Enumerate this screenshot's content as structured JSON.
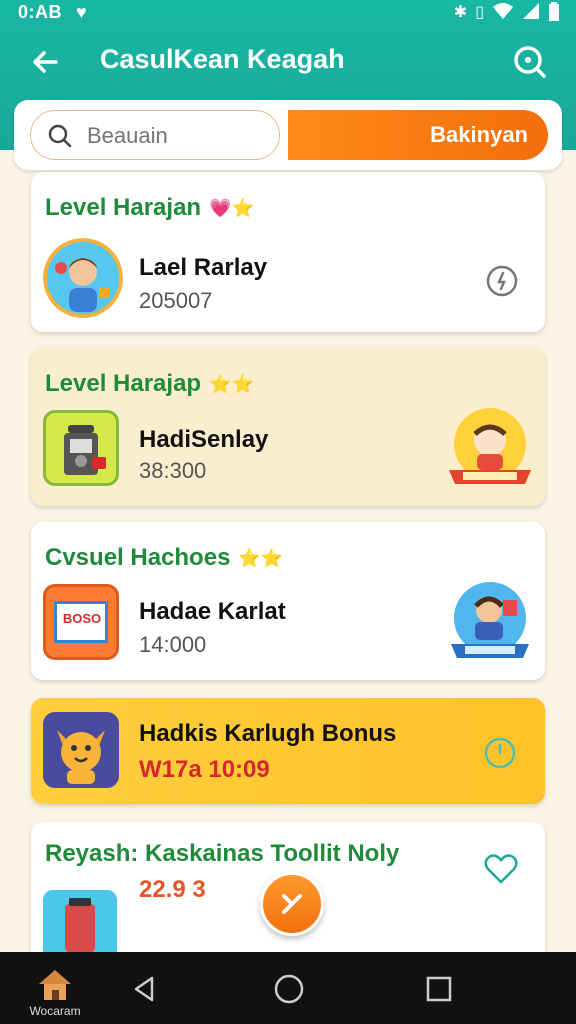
{
  "status": {
    "time": "0:AB",
    "icons": [
      "heart-icon",
      "bluetooth-icon",
      "vibrate-icon",
      "wifi-icon",
      "signal-icon",
      "battery-icon"
    ]
  },
  "appbar": {
    "title": "CasulKean Keagah"
  },
  "search": {
    "placeholder": "Beauain",
    "button_label": "Bakinyan"
  },
  "cards": [
    {
      "title": "Level Harajan",
      "stars": "💗⭐",
      "item_name": "Lael Rarlay",
      "item_value": "205007"
    },
    {
      "title": "Level Harajap",
      "stars": "⭐⭐",
      "item_name": "HadiSenlay",
      "item_value": "38:300"
    },
    {
      "title": "Cvsuel Hachoes",
      "stars": "⭐⭐",
      "item_name": "Hadae Karlat",
      "item_value": "14:000",
      "icon_label": "BOSO"
    },
    {
      "item_name": "Hadkis Karlugh Bonus",
      "item_value": "W17a 10:09"
    },
    {
      "title": "Reyash: Kaskainas Toollit Noly",
      "item_value": "22.9 3"
    }
  ],
  "navbar": {
    "home_label": "Wocaram"
  },
  "colors": {
    "teal": "#18b8a4",
    "orange": "#f47a12",
    "green_title": "#1f8b3a",
    "red_value": "#d7262e",
    "bonus_yellow": "#ffc22a"
  }
}
